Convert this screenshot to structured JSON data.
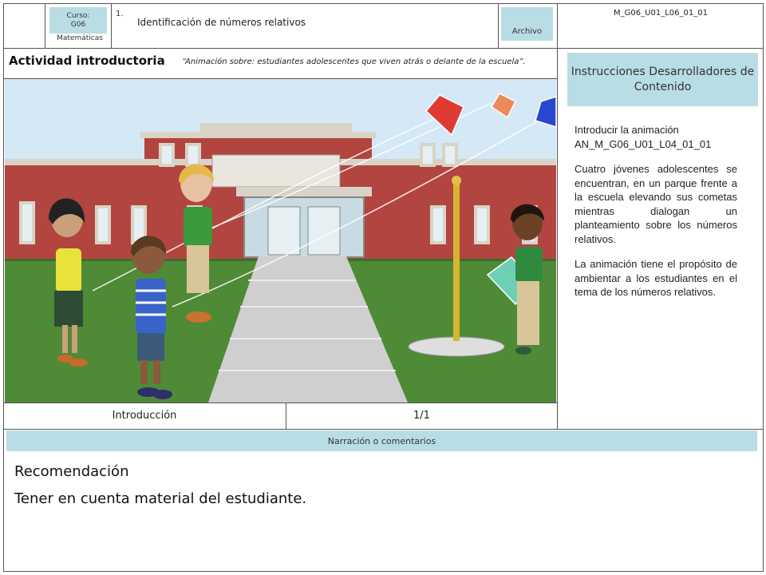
{
  "header": {
    "course_label": "Curso:",
    "course_value": "G06",
    "subject": "Matemáticas",
    "number": "1.",
    "title": "Identificación de números relativos",
    "archivo": "Archivo",
    "code": "M_G06_U01_L06_01_01"
  },
  "activity": {
    "title": "Actividad introductoria",
    "subtitle": "“Animación sobre: estudiantes adolescentes que viven atrás o delante de la escuela”."
  },
  "instructions": {
    "heading": "Instrucciones Desarrolladores de Contenido",
    "p1": "Introducir la animación AN_M_G06_U01_L04_01_01",
    "p2": "Cuatro jóvenes adolescentes se encuentran, en un parque frente a la escuela elevando sus cometas mientras dialogan un planteamiento sobre los números relativos.",
    "p3": "La animación tiene el propósito de ambientar a los estudiantes en el tema de los números relativos."
  },
  "footer": {
    "section": "Introducción",
    "page": "1/1"
  },
  "narration": {
    "heading": "Narración o comentarios",
    "rec_title": "Recomendación",
    "rec_text": "Tener en cuenta material del estudiante."
  },
  "colors": {
    "accent_box": "#b9dde4",
    "border": "#555555"
  }
}
